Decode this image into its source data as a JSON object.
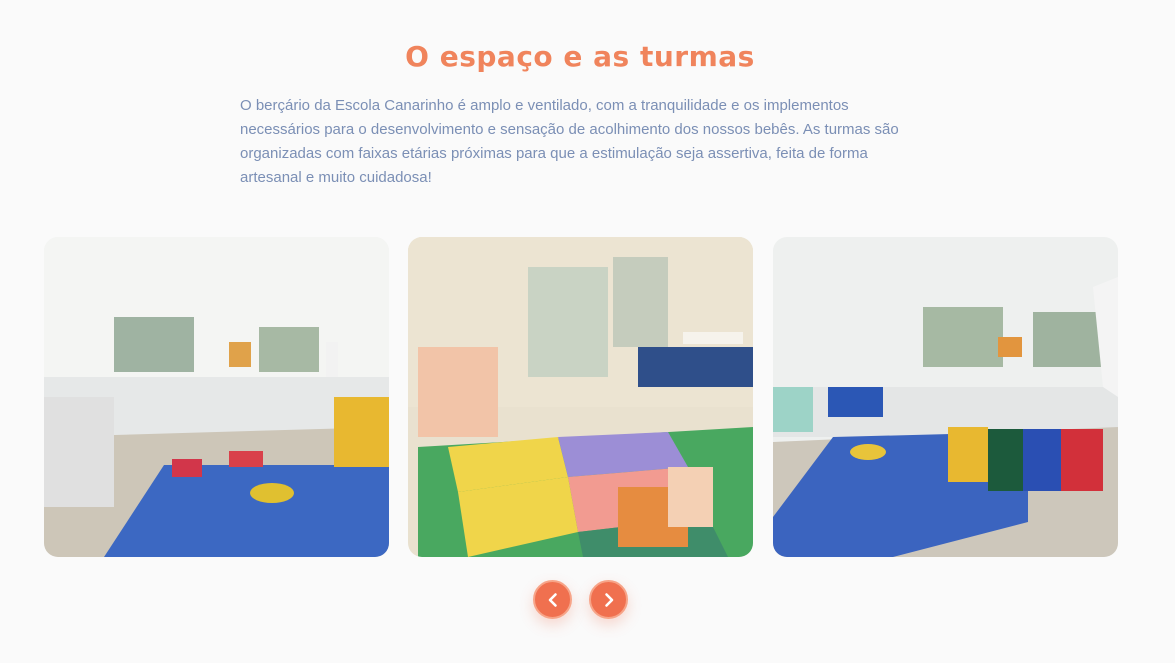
{
  "section": {
    "title": "O espaço e as turmas",
    "description": "O berçário da Escola Canarinho é amplo e ventilado, com a tranquilidade e os implementos necessários para o desenvolvimento e sensação de acolhimento dos nossos bebês. As turmas são organizadas com faixas etárias próximas para que a estimulação seja assertiva, feita de forma artesanal e muito cuidadosa!"
  },
  "carousel": {
    "prev_icon": "chevron-left-icon",
    "next_icon": "chevron-right-icon"
  },
  "colors": {
    "accent": "#f0704f",
    "title": "#f0845c",
    "text": "#7b8fb5",
    "background": "#fafafa"
  }
}
